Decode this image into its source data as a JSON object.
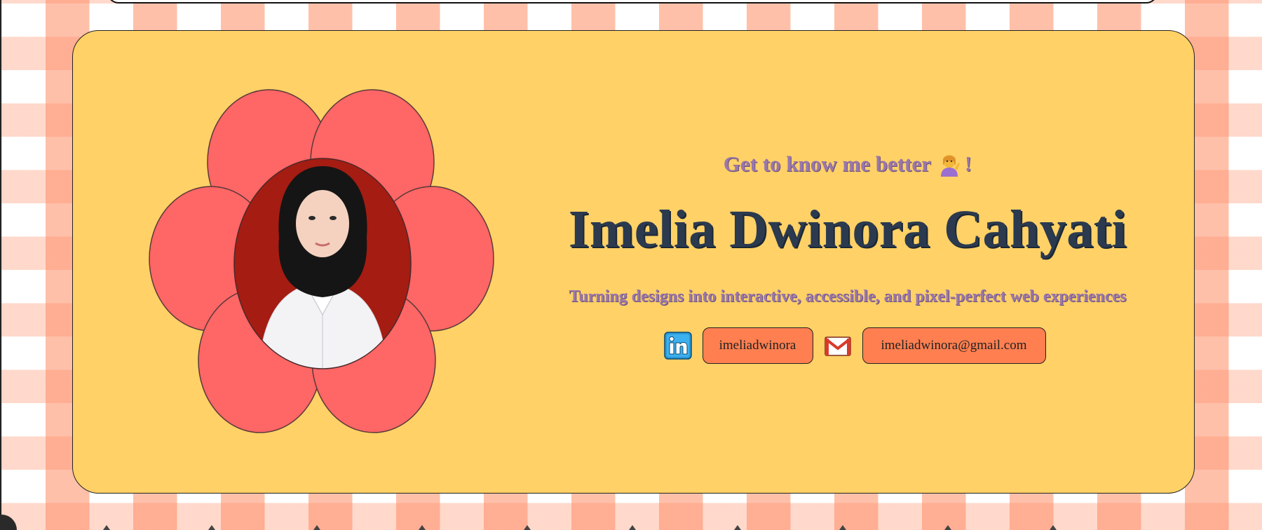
{
  "hero": {
    "tagline": "Get to know me better",
    "tagline_suffix": "!",
    "tagline_icon": "person-tipping-hand-emoji",
    "name": "Imelia Dwinora Cahyati",
    "subtitle": "Turning designs into interactive, accessible, and pixel-perfect web experiences"
  },
  "contacts": {
    "linkedin_icon": "linkedin-icon",
    "linkedin_label": "imeliadwinora",
    "email_icon": "gmail-icon",
    "email_label": "imeliadwinora@gmail.com"
  },
  "colors": {
    "card_background": "#ffd166",
    "petal": "#ff6666",
    "photo_background": "#a51c12",
    "button": "#ff7f50",
    "tagline": "#9a78ab",
    "name": "#2b3a4f",
    "checker": "#ff8c64"
  }
}
